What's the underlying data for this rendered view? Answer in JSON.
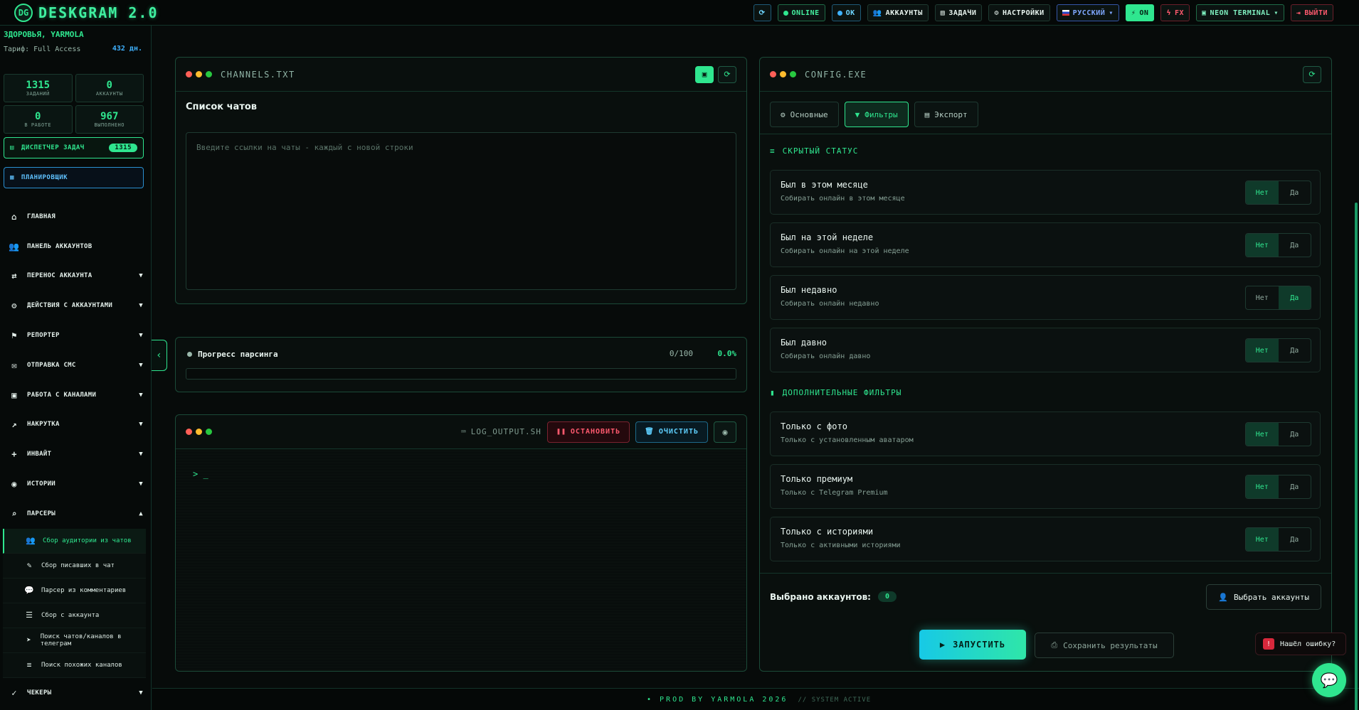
{
  "app": {
    "logo_mark": "DG",
    "title": "DESKGRAM 2.0"
  },
  "topbar": {
    "refresh_icon": "refresh-icon",
    "status_online": "ONLINE",
    "status_ok": "OK",
    "accounts": "АККАУНТЫ",
    "tasks": "ЗАДАЧИ",
    "settings": "НАСТРОЙКИ",
    "language": "РУССКИЙ",
    "fx_on": "ON",
    "fx": "FX",
    "theme": "NEON TERMINAL",
    "logout": "ВЫЙТИ"
  },
  "sidebar": {
    "greeting": "ЗДОРОВЬЯ, YARMOLA",
    "plan": "Тариф: Full Access",
    "days_left": "432 дн.",
    "stats": [
      {
        "value": "1315",
        "label": "ЗАДАНИЙ"
      },
      {
        "value": "0",
        "label": "АККАУНТЫ"
      },
      {
        "value": "0",
        "label": "В РАБОТЕ"
      },
      {
        "value": "967",
        "label": "ВЫПОЛНЕНО"
      }
    ],
    "task_manager": {
      "label": "ДИСПЕТЧЕР ЗАДАЧ",
      "count": "1315"
    },
    "scheduler": "ПЛАНИРОВЩИК",
    "nav": [
      {
        "label": "ГЛАВНАЯ",
        "icon": "home-icon"
      },
      {
        "label": "ПАНЕЛЬ АККАУНТОВ",
        "icon": "users-icon"
      },
      {
        "label": "ПЕРЕНОС АККАУНТА",
        "icon": "user-transfer-icon"
      },
      {
        "label": "ДЕЙСТВИЯ С АККАУНТАМИ",
        "icon": "user-gear-icon"
      },
      {
        "label": "РЕПОРТЕР",
        "icon": "flag-icon"
      },
      {
        "label": "ОТПРАВКА СМС",
        "icon": "message-icon"
      },
      {
        "label": "РАБОТА С КАНАЛАМИ",
        "icon": "briefcase-icon"
      },
      {
        "label": "НАКРУТКА",
        "icon": "chart-line-icon"
      },
      {
        "label": "ИНВАЙТ",
        "icon": "user-plus-icon"
      },
      {
        "label": "ИСТОРИИ",
        "icon": "camera-icon"
      },
      {
        "label": "ПАРСЕРЫ",
        "icon": "search-icon"
      }
    ],
    "parsers": [
      {
        "label": "Сбор аудитории из чатов",
        "icon": "users-icon"
      },
      {
        "label": "Сбор писавших в чат",
        "icon": "pen-icon"
      },
      {
        "label": "Парсер из комментариев",
        "icon": "comment-icon"
      },
      {
        "label": "Сбор с аккаунта",
        "icon": "user-list-icon"
      },
      {
        "label": "Поиск чатов/каналов в телеграм",
        "icon": "telegram-icon"
      },
      {
        "label": "Поиск похожих каналов",
        "icon": "database-icon"
      }
    ],
    "checkers": "ЧЕКЕРЫ"
  },
  "chats_panel": {
    "file": "CHANNELS.TXT",
    "title": "Список чатов",
    "placeholder": "Введите ссылки на чаты - каждый с новой строки"
  },
  "progress": {
    "label": "Прогресс парсинга",
    "count": "0/100",
    "percent": "0.0%",
    "value": 0
  },
  "log": {
    "file": "LOG_OUTPUT.SH",
    "stop": "ОСТАНОВИТЬ",
    "clear": "ОЧИСТИТЬ",
    "prompt": "> _"
  },
  "config": {
    "file": "CONFIG.EXE",
    "tabs": [
      "Основные",
      "Фильтры",
      "Экспорт"
    ],
    "active_tab": "Фильтры",
    "hidden_status_title": "СКРЫТЫЙ СТАТУС",
    "extra_filters_title": "ДОПОЛНИТЕЛЬНЫЕ ФИЛЬТРЫ",
    "toggle_no": "Нет",
    "toggle_yes": "Да",
    "hidden_status": [
      {
        "title": "Был в этом месяце",
        "desc": "Собирать онлайн в этом месяце",
        "value": "Нет"
      },
      {
        "title": "Был на этой неделе",
        "desc": "Собирать онлайн на этой неделе",
        "value": "Нет"
      },
      {
        "title": "Был недавно",
        "desc": "Собирать онлайн недавно",
        "value": "Да"
      },
      {
        "title": "Был давно",
        "desc": "Собирать онлайн давно",
        "value": "Нет"
      }
    ],
    "extra_filters": [
      {
        "title": "Только с фото",
        "desc": "Только с установленным аватаром",
        "value": "Нет"
      },
      {
        "title": "Только премиум",
        "desc": "Только с Telegram Premium",
        "value": "Нет"
      },
      {
        "title": "Только с историями",
        "desc": "Только с активными историями",
        "value": "Нет"
      }
    ],
    "selected_accounts_label": "Выбрано аккаунтов:",
    "selected_accounts": "0",
    "choose_accounts": "Выбрать аккаунты",
    "launch": "ЗАПУСТИТЬ",
    "save": "Сохранить результаты"
  },
  "footer": {
    "text": "• PROD BY YARMOLA 2026",
    "sub": "// SYSTEM ACTIVE"
  },
  "help": {
    "bug": "Нашёл ошибку?"
  },
  "colors": {
    "accent": "#2fe68f",
    "cyan": "#17c9e6",
    "danger": "#ff5a6e",
    "bg": "#070b0a"
  }
}
